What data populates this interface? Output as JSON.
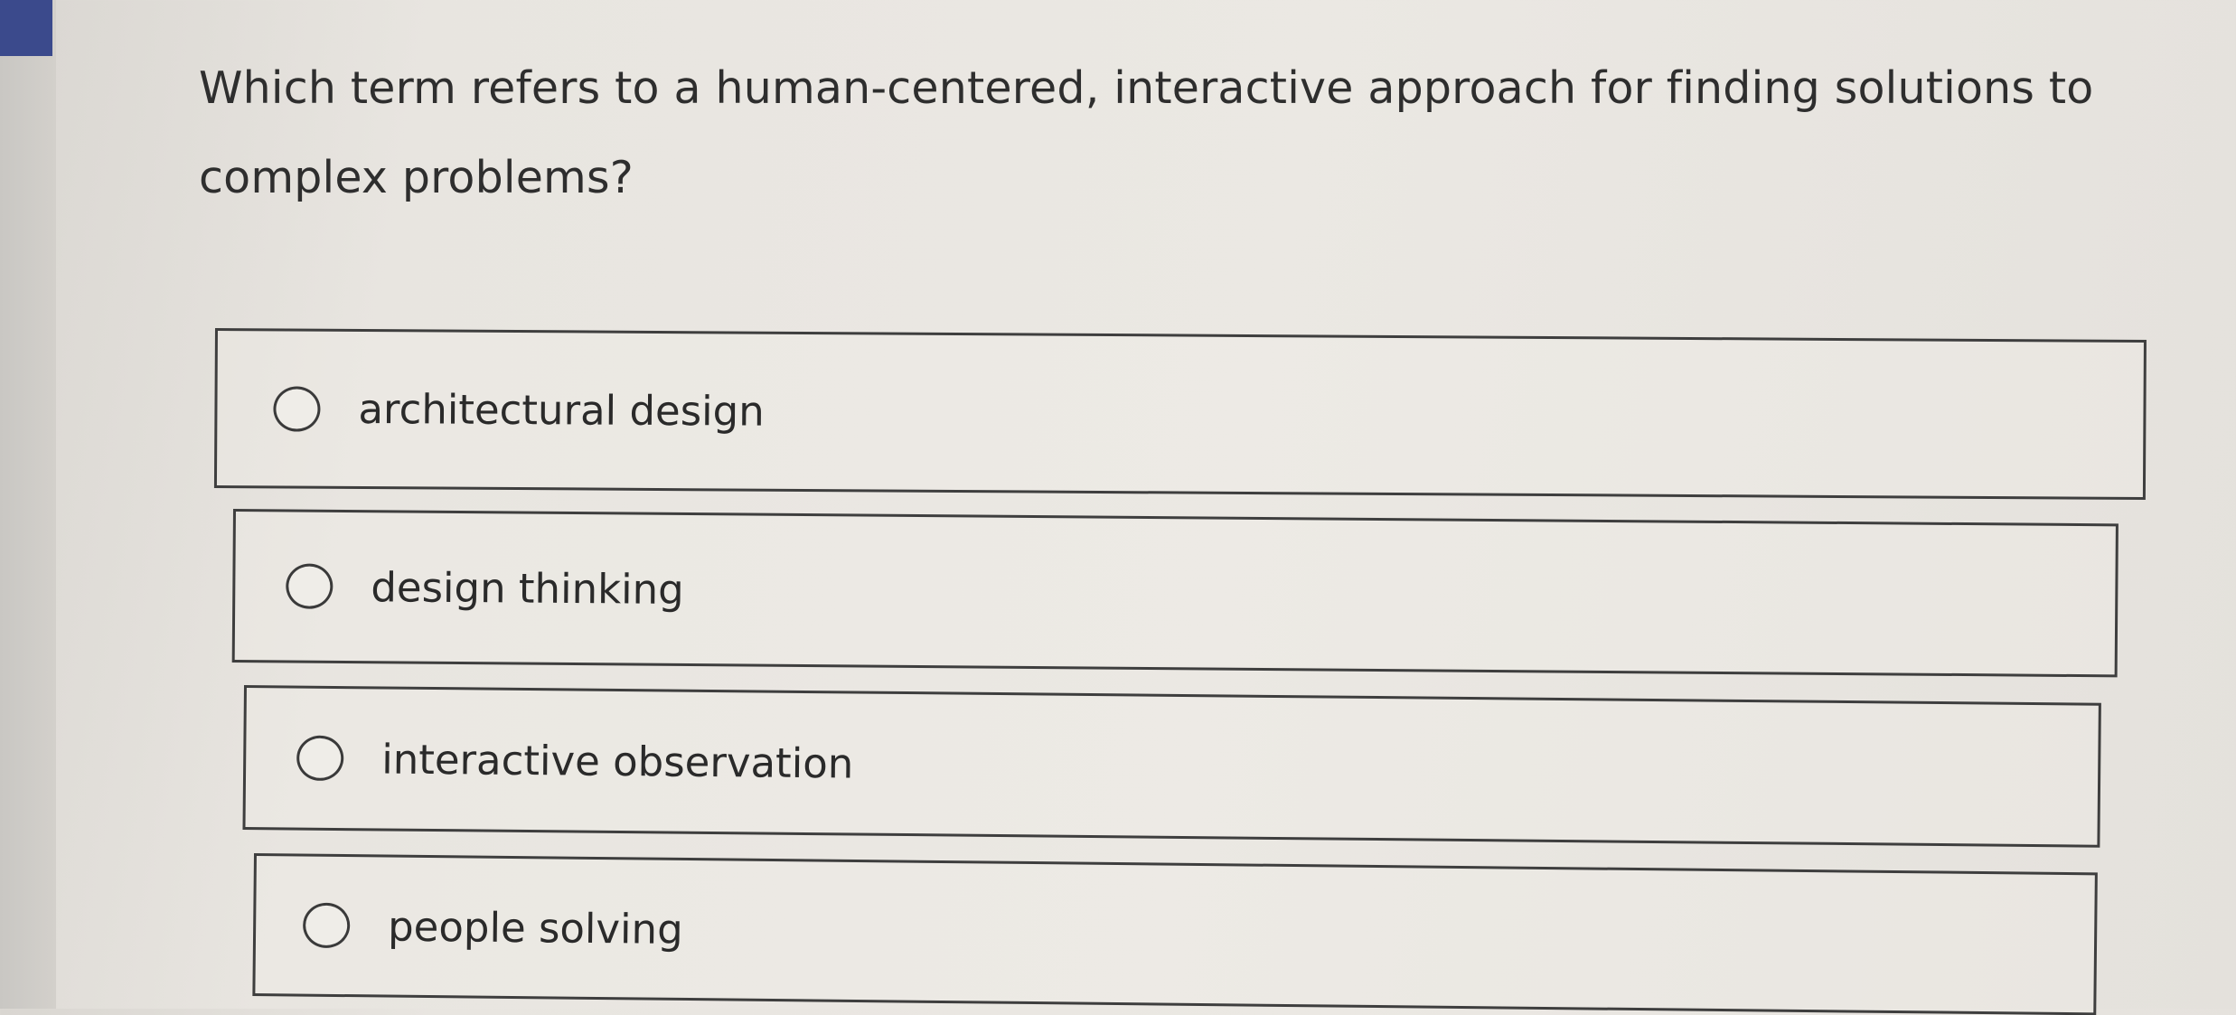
{
  "question": {
    "text": "Which term refers to a human-centered, interactive approach for finding solutions to complex problems?"
  },
  "options": [
    {
      "label": "architectural design",
      "selected": false
    },
    {
      "label": "design thinking",
      "selected": false
    },
    {
      "label": "interactive observation",
      "selected": false
    },
    {
      "label": "people solving",
      "selected": false
    }
  ],
  "colors": {
    "accent_tab": "#3b4a8c",
    "border": "#3e3e3e",
    "background": "#e8e5e0"
  }
}
